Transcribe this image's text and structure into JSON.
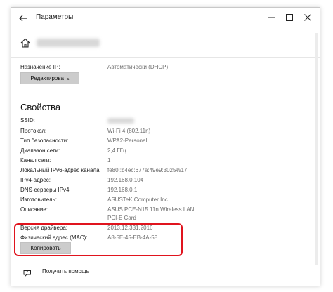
{
  "window": {
    "title": "Параметры",
    "back_icon": "back-arrow-icon",
    "controls": [
      "minimize-icon",
      "maximize-icon",
      "close-icon"
    ]
  },
  "header": {
    "icon": "home-icon",
    "network_name_blurred": true
  },
  "ip_assignment": {
    "label": "Назначение IP:",
    "value": "Автоматически (DHCP)",
    "edit_button": "Редактировать"
  },
  "properties": {
    "title": "Свойства",
    "rows": [
      {
        "label": "SSID:",
        "value": ""
      },
      {
        "label": "Протокол:",
        "value": "Wi-Fi 4 (802.11n)"
      },
      {
        "label": "Тип безопасности:",
        "value": "WPA2-Personal"
      },
      {
        "label": "Диапазон сети:",
        "value": "2,4 ГГц"
      },
      {
        "label": "Канал сети:",
        "value": "1"
      },
      {
        "label": "Локальный IPv6-адрес канала:",
        "value": "fe80::b4ec:677a:49e9:3025%17"
      },
      {
        "label": "IPv4-адрес:",
        "value": "192.168.0.104"
      },
      {
        "label": "DNS-серверы IPv4:",
        "value": "192.168.0.1"
      },
      {
        "label": "Изготовитель:",
        "value": "ASUSTeK Computer Inc."
      },
      {
        "label": "Описание:",
        "value": "ASUS PCE-N15 11n Wireless LAN",
        "value2": "PCI-E Card"
      },
      {
        "label": "Версия драйвера:",
        "value": "2013.12.331.2016"
      },
      {
        "label": "Физический адрес (MAC):",
        "value": "A8-5E-45-EB-4A-58"
      }
    ],
    "copy_button": "Копировать"
  },
  "help": {
    "icon": "help-icon",
    "label": "Получить помощь"
  },
  "colors": {
    "highlight": "#e0141e",
    "button_bg": "#cccccc",
    "value_text": "#6e6e6e"
  }
}
